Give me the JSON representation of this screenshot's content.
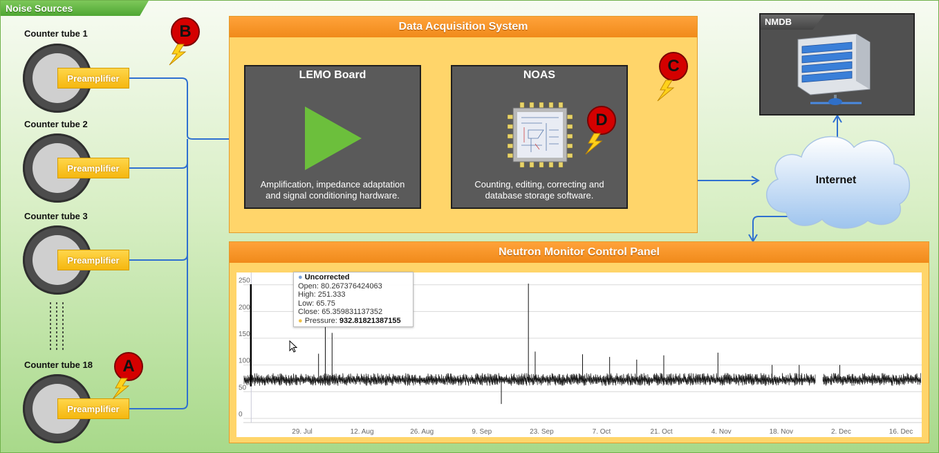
{
  "noise_sources": {
    "label": "Noise Sources"
  },
  "tubes": [
    {
      "label": "Counter tube 1",
      "preamp": "Preamplifier"
    },
    {
      "label": "Counter tube 2",
      "preamp": "Preamplifier"
    },
    {
      "label": "Counter tube 3",
      "preamp": "Preamplifier"
    },
    {
      "label": "Counter tube 18",
      "preamp": "Preamplifier"
    }
  ],
  "markers": {
    "a": "A",
    "b": "B",
    "c": "C",
    "d": "D"
  },
  "daq": {
    "title": "Data Acquisition System",
    "lemo": {
      "title": "LEMO Board",
      "line1": "Amplification, impedance adaptation",
      "line2": "and signal conditioning hardware."
    },
    "noas": {
      "title": "NOAS",
      "line1": "Counting, editing, correcting and",
      "line2": "database storage software."
    }
  },
  "nmdb": {
    "label": "NMDB"
  },
  "internet": {
    "label": "Internet"
  },
  "control_panel": {
    "title": "Neutron Monitor Control Panel"
  },
  "colors": {
    "orange": "#f08a1a",
    "panel": "#ffd56a",
    "connector": "#2e6fd0",
    "marker": "#d40000",
    "triangle": "#6cbf3c"
  },
  "chart_data": {
    "type": "line",
    "ylim": [
      0,
      260
    ],
    "yticks": [
      0,
      50,
      100,
      150,
      200,
      250
    ],
    "xticks": [
      "29. Jul",
      "12. Aug",
      "26. Aug",
      "9. Sep",
      "23. Sep",
      "7. Oct",
      "21. Oct",
      "4. Nov",
      "18. Nov",
      "2. Dec",
      "16. Dec"
    ],
    "series": [
      {
        "name": "Uncorrected",
        "baseline": 72,
        "spikes": [
          [
            1,
            251
          ],
          [
            11,
            121
          ],
          [
            12,
            174
          ],
          [
            13,
            160
          ],
          [
            38,
            27
          ],
          [
            42,
            252
          ],
          [
            43,
            125
          ],
          [
            50,
            120
          ],
          [
            54,
            115
          ],
          [
            58,
            110
          ],
          [
            62,
            118
          ],
          [
            70,
            123
          ],
          [
            78,
            100
          ],
          [
            82,
            100
          ],
          [
            88,
            100
          ]
        ],
        "gap": [
          84.5,
          85.5
        ]
      },
      {
        "name": "Pressure"
      }
    ],
    "tooltip": {
      "series": "Uncorrected",
      "open_label": "Open:",
      "open": "80.267376424063",
      "high_label": "High:",
      "high": "251.333",
      "low_label": "Low:",
      "low": "65.75",
      "close_label": "Close:",
      "close": "65.359831137352",
      "pressure_label": "Pressure:",
      "pressure": "932.81821387155"
    }
  }
}
